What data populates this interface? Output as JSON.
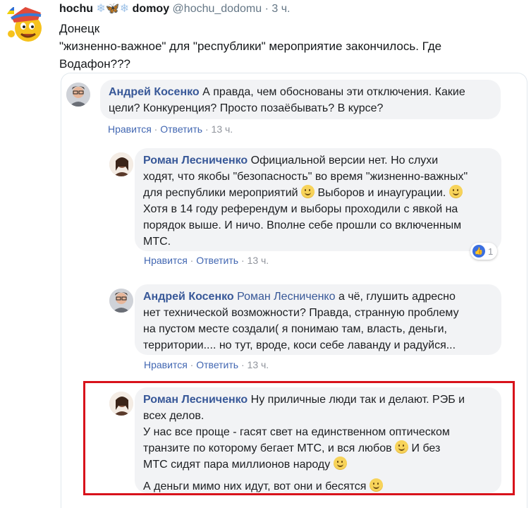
{
  "tweet": {
    "display_name_1": "hochu",
    "display_name_2": "domoy",
    "handle": "@hochu_dodomu",
    "dot": "·",
    "time": "3 ч.",
    "text_lines": [
      "Донецк",
      "\"жизненно-важное\" для \"республики\" мероприятие закончилось. Где",
      "Водафон???"
    ]
  },
  "comments": [
    {
      "author": "Андрей Косенко",
      "lines": [
        " А правда, чем обоснованы эти отключения. Какие",
        "цели? Конкуренция? Просто позаёбывать? В курсе?"
      ],
      "like": "Нравится",
      "reply": "Ответить",
      "time": "13 ч."
    },
    {
      "author": "Роман Лесниченко",
      "line1": " Официальной версии нет. Но слухи",
      "line2": "ходят, что якобы \"безопасность\" во время \"жизненно-важных\"",
      "line3a": "для республики мероприятий ",
      "line3b": " Выборов и инаугурации. ",
      "line4": "Хотя в 14 году референдум и выборы проходили с явкой на",
      "line5": "порядок выше. И ничо. Вполне себе прошли со включенным",
      "line6": "МТС.",
      "reaction_count": "1",
      "like": "Нравится",
      "reply": "Ответить",
      "time": "13 ч."
    },
    {
      "author": "Андрей Косенко",
      "mention": " Роман Лесниченко",
      "line1": " а чё, глушить адресно",
      "line2": "нет технической возможности? Правда, странную проблему",
      "line3": "на пустом месте создали( я понимаю там, власть, деньги,",
      "line4": "территории.... но тут, вроде, коси себе лаванду и радуйся...",
      "like": "Нравится",
      "reply": "Ответить",
      "time": "13 ч."
    },
    {
      "author": "Роман Лесниченко",
      "line1": " Ну приличные люди так и делают. РЭБ и",
      "line2": "всех делов.",
      "line3": "У нас все проще - гасят свет на единственном оптическом",
      "line4a": "транзите по которому бегает МТС, и вся любов ",
      "line4b": " И без",
      "line5a": "МТС сидят пара миллионов народу ",
      "line6a": "А деньги мимо них идут, вот они и бесятся "
    }
  ],
  "separator": "·",
  "colors": {
    "link": "#385898",
    "highlight": "#d8121b",
    "bubble": "#f2f3f5"
  }
}
